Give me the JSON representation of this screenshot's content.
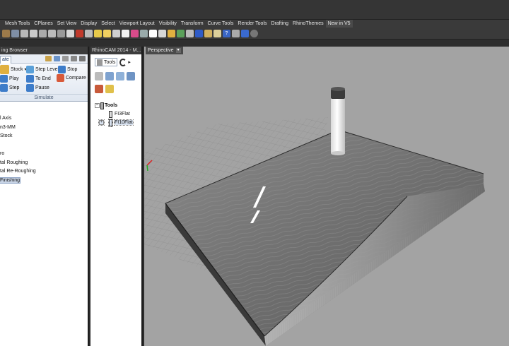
{
  "toolbar_tabs": [
    "Mesh Tools",
    "CPlanes",
    "Set View",
    "Display",
    "Select",
    "Viewport Layout",
    "Visibility",
    "Transform",
    "Curve Tools",
    "Render Tools",
    "Drafting",
    "RhinoThemes",
    "New in V5"
  ],
  "left_panel": {
    "title": "ing Browser",
    "tab_label": "ate",
    "ribbon": {
      "stock": "Stock",
      "step_levels": "Step Levels",
      "stop": "Stop",
      "play": "Play",
      "to_end": "To End",
      "compare": "Compare",
      "step": "Step",
      "pause": "Pause",
      "group_label": "Simulate"
    },
    "tree_items": [
      "l Axis",
      "n3-MM",
      "Stock",
      "",
      "ro",
      "tal Roughing",
      "tal Re-Roughing",
      "Finishing"
    ]
  },
  "mid_panel": {
    "title": "RhinoCAM 2014 - M...",
    "tab_label": "Tools",
    "tree_root": "Tools",
    "tools": [
      "FI3Flat",
      "FI10Flat"
    ]
  },
  "viewport": {
    "label": "Perspective"
  },
  "colors": {
    "ui_dark": "#2b2b2b",
    "viewport_bg": "#a3a3a3",
    "panel_bg": "#ffffff"
  }
}
